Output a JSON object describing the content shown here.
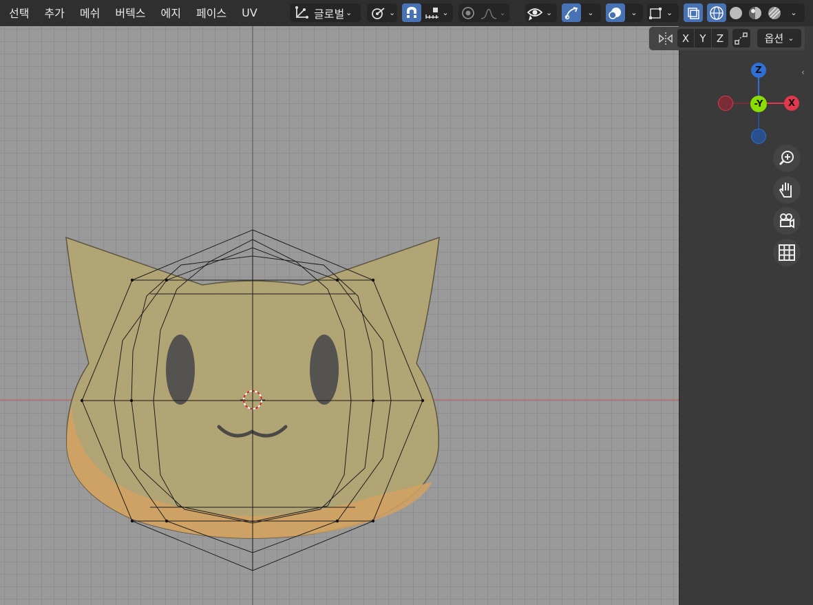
{
  "menu": {
    "items": [
      "선택",
      "추가",
      "메쉬",
      "버텍스",
      "에지",
      "페이스",
      "UV"
    ]
  },
  "toolbar": {
    "orientation": "글로벌",
    "options_label": "옵션"
  },
  "axis_buttons": [
    "X",
    "Y",
    "Z"
  ],
  "gizmo": {
    "z": "Z",
    "y": "-Y",
    "x": "X"
  },
  "colors": {
    "accent": "#4772b3",
    "x_axis": "#e2384d",
    "y_axis": "#8bdc00",
    "z_axis": "#2f6fd6",
    "mesh_fill": "#b8a96e",
    "mesh_shadow": "#d3a56a"
  },
  "icons": [
    "transform-orientation-icon",
    "pivot-icon",
    "snap-icon",
    "snap-increment-icon",
    "proportional-editing-icon",
    "falloff-icon",
    "visibility-icon",
    "gizmo-icon",
    "overlay-icon",
    "mesh-edit-overlay-icon",
    "xray-icon",
    "wireframe-shading-icon",
    "solid-shading-icon",
    "material-shading-icon",
    "rendered-shading-icon",
    "mirror-icon",
    "auto-merge-icon",
    "zoom-icon",
    "hand-icon",
    "camera-icon",
    "grid-icon"
  ]
}
